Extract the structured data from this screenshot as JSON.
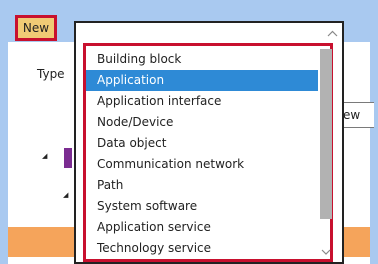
{
  "toolbar": {
    "new_label": "New"
  },
  "form": {
    "type_label": "Type"
  },
  "right_button": {
    "label": "ew"
  },
  "dropdown": {
    "selected": "Application",
    "items": [
      {
        "label": "Building block"
      },
      {
        "label": "Application"
      },
      {
        "label": "Application interface"
      },
      {
        "label": "Node/Device"
      },
      {
        "label": "Data object"
      },
      {
        "label": "Communication network"
      },
      {
        "label": "Path"
      },
      {
        "label": "System software"
      },
      {
        "label": "Application service"
      },
      {
        "label": "Technology service"
      }
    ]
  },
  "icons": {
    "up": "chevron-up-icon",
    "down": "chevron-down-icon",
    "expand": "expand-triangle-icon"
  },
  "colors": {
    "highlight": "#c8102e",
    "selection": "#2e8ad6",
    "new_button": "#f0cb75",
    "frame": "#a9c9f0",
    "orange_bar": "#f5a45b",
    "purple_marker": "#7b2c91"
  }
}
